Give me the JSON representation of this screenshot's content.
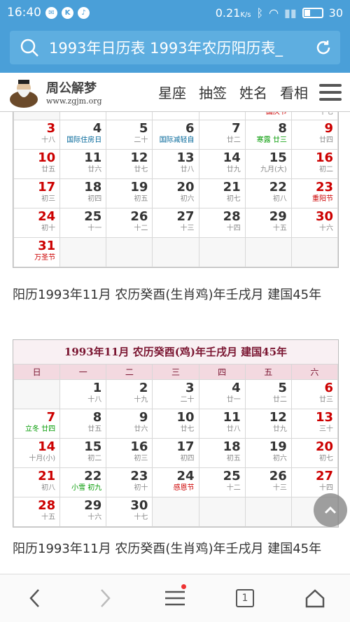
{
  "status": {
    "time": "16:40",
    "speed": "0.21",
    "speed_unit": "K/s",
    "battery": "30"
  },
  "urlbar": {
    "text": "1993年日历表 1993年农历阳历表_"
  },
  "site": {
    "logo_cn": "周公解梦",
    "logo_url": "www.zgjm.org",
    "nav": [
      "星座",
      "抽签",
      "姓名",
      "看相"
    ]
  },
  "oct": {
    "top_row": [
      {
        "d": "",
        "l": "",
        "cls": "empty"
      },
      {
        "d": "",
        "l": ""
      },
      {
        "d": "",
        "l": ""
      },
      {
        "d": "",
        "l": ""
      },
      {
        "d": "",
        "l": ""
      },
      {
        "d": "",
        "l": "国庆节",
        "lc": "fest"
      },
      {
        "d": "",
        "l": "十七",
        "we": true
      }
    ],
    "rows": [
      [
        {
          "d": "3",
          "l": "十八",
          "we": true
        },
        {
          "d": "4",
          "l": "国际住房日",
          "lc": "intl"
        },
        {
          "d": "5",
          "l": "二十"
        },
        {
          "d": "6",
          "l": "国际减轻自",
          "lc": "intl"
        },
        {
          "d": "7",
          "l": "廿二"
        },
        {
          "d": "8",
          "l": "寒露 廿三",
          "lc": "term"
        },
        {
          "d": "9",
          "l": "廿四",
          "we": true
        }
      ],
      [
        {
          "d": "10",
          "l": "廿五",
          "we": true
        },
        {
          "d": "11",
          "l": "廿六"
        },
        {
          "d": "12",
          "l": "廿七"
        },
        {
          "d": "13",
          "l": "廿八"
        },
        {
          "d": "14",
          "l": "廿九"
        },
        {
          "d": "15",
          "l": "九月(大)"
        },
        {
          "d": "16",
          "l": "初二",
          "we": true
        }
      ],
      [
        {
          "d": "17",
          "l": "初三",
          "we": true
        },
        {
          "d": "18",
          "l": "初四"
        },
        {
          "d": "19",
          "l": "初五"
        },
        {
          "d": "20",
          "l": "初六"
        },
        {
          "d": "21",
          "l": "初七"
        },
        {
          "d": "22",
          "l": "初八"
        },
        {
          "d": "23",
          "l": "重阳节",
          "we": true,
          "lc": "fest"
        }
      ],
      [
        {
          "d": "24",
          "l": "初十",
          "we": true
        },
        {
          "d": "25",
          "l": "十一"
        },
        {
          "d": "26",
          "l": "十二"
        },
        {
          "d": "27",
          "l": "十三"
        },
        {
          "d": "28",
          "l": "十四"
        },
        {
          "d": "29",
          "l": "十五"
        },
        {
          "d": "30",
          "l": "十六",
          "we": true
        }
      ],
      [
        {
          "d": "31",
          "l": "万圣节",
          "we": true,
          "lc": "fest"
        },
        {
          "d": "",
          "l": "",
          "cls": "empty"
        },
        {
          "d": "",
          "l": "",
          "cls": "empty"
        },
        {
          "d": "",
          "l": "",
          "cls": "empty"
        },
        {
          "d": "",
          "l": "",
          "cls": "empty"
        },
        {
          "d": "",
          "l": "",
          "cls": "empty"
        },
        {
          "d": "",
          "l": "",
          "cls": "empty"
        }
      ]
    ]
  },
  "para1": "阳历1993年11月 农历癸酉(生肖鸡)年壬戌月 建国45年",
  "nov": {
    "title": "1993年11月 农历癸酉(鸡)年壬戌月 建国45年",
    "weekdays": [
      "日",
      "一",
      "二",
      "三",
      "四",
      "五",
      "六"
    ],
    "rows": [
      [
        {
          "d": "",
          "l": "",
          "cls": "empty"
        },
        {
          "d": "1",
          "l": "十八"
        },
        {
          "d": "2",
          "l": "十九"
        },
        {
          "d": "3",
          "l": "二十"
        },
        {
          "d": "4",
          "l": "廿一"
        },
        {
          "d": "5",
          "l": "廿二"
        },
        {
          "d": "6",
          "l": "廿三",
          "we": true
        }
      ],
      [
        {
          "d": "7",
          "l": "立冬 廿四",
          "we": true,
          "lc": "term"
        },
        {
          "d": "8",
          "l": "廿五"
        },
        {
          "d": "9",
          "l": "廿六"
        },
        {
          "d": "10",
          "l": "廿七"
        },
        {
          "d": "11",
          "l": "廿八"
        },
        {
          "d": "12",
          "l": "廿九"
        },
        {
          "d": "13",
          "l": "三十",
          "we": true
        }
      ],
      [
        {
          "d": "14",
          "l": "十月(小)",
          "we": true
        },
        {
          "d": "15",
          "l": "初二"
        },
        {
          "d": "16",
          "l": "初三"
        },
        {
          "d": "17",
          "l": "初四"
        },
        {
          "d": "18",
          "l": "初五"
        },
        {
          "d": "19",
          "l": "初六"
        },
        {
          "d": "20",
          "l": "初七",
          "we": true
        }
      ],
      [
        {
          "d": "21",
          "l": "初八",
          "we": true
        },
        {
          "d": "22",
          "l": "小雪 初九",
          "lc": "term"
        },
        {
          "d": "23",
          "l": "初十"
        },
        {
          "d": "24",
          "l": "感恩节",
          "lc": "fest"
        },
        {
          "d": "25",
          "l": "十二"
        },
        {
          "d": "26",
          "l": "十三"
        },
        {
          "d": "27",
          "l": "十四",
          "we": true
        }
      ],
      [
        {
          "d": "28",
          "l": "十五",
          "we": true
        },
        {
          "d": "29",
          "l": "十六"
        },
        {
          "d": "30",
          "l": "十七"
        },
        {
          "d": "",
          "l": "",
          "cls": "empty"
        },
        {
          "d": "",
          "l": "",
          "cls": "empty"
        },
        {
          "d": "",
          "l": "",
          "cls": "empty"
        },
        {
          "d": "",
          "l": "",
          "cls": "empty"
        }
      ]
    ]
  },
  "para2": "阳历1993年11月 农历癸酉(生肖鸡)年壬戌月 建国45年",
  "bottom": {
    "tabs_count": "1"
  }
}
